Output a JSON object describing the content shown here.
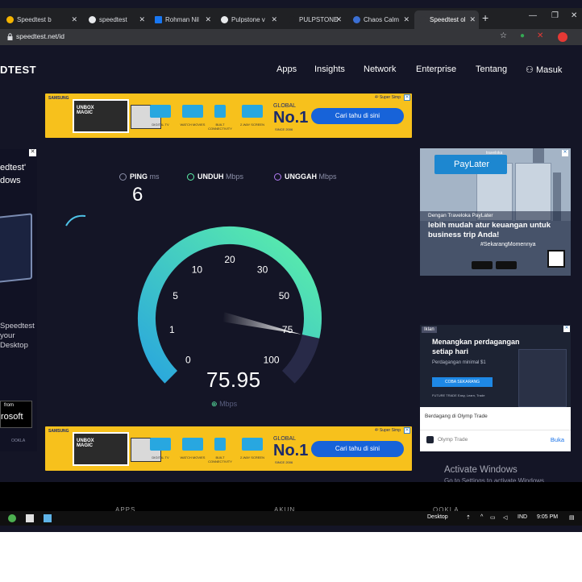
{
  "browser": {
    "tabs": [
      {
        "label": "Speedtest b"
      },
      {
        "label": "speedtest"
      },
      {
        "label": "Rohman Nil"
      },
      {
        "label": "Pulpstone v"
      },
      {
        "label": "PULPSTONE"
      },
      {
        "label": "Chaos Calm"
      },
      {
        "label": "Speedtest ol"
      }
    ],
    "url": "speedtest.net/id"
  },
  "site": {
    "logo": "DTEST",
    "nav": [
      "Apps",
      "Insights",
      "Network",
      "Enterprise",
      "Tentang"
    ],
    "login": "Masuk"
  },
  "banner_ad": {
    "brand": "SAMSUNG",
    "box_text": "UNBOX MAGIC",
    "features": [
      "DIGITAL TV",
      "WATCH MOVIES",
      "BUILT CONNECTIVITY",
      "2-WAY SCREEN"
    ],
    "global": "GLOBAL",
    "no1": "No.1",
    "since": "SINCE 2006",
    "super_simple": "4² Super Simp",
    "cta": "Cari tahu di sini"
  },
  "left_ad": {
    "line1": "edtest'",
    "line2": "dows",
    "line3": "Speedtest",
    "line4": "your",
    "line5": "Desktop",
    "ms_top": "from",
    "ms_bottom": "rosoft",
    "ookla": "OOKLA"
  },
  "metrics": {
    "ping_label": "PING",
    "ping_unit": "ms",
    "ping_value": "6",
    "download_label": "UNDUH",
    "download_unit": "Mbps",
    "upload_label": "UNGGAH",
    "upload_unit": "Mbps"
  },
  "gauge": {
    "ticks": [
      "0",
      "1",
      "5",
      "10",
      "20",
      "30",
      "50",
      "75",
      "100"
    ],
    "speed": "75.95",
    "unit": "Mbps",
    "needle_value": 75.95,
    "colors": {
      "low": "#2aa7dd",
      "high": "#5cf0a8",
      "track": "#282a48"
    }
  },
  "travel_ad": {
    "brand": "traveloka",
    "product": "PayLater",
    "line1": "Dengan Traveloka PayLater",
    "line2": "lebih mudah atur keuangan untuk business trip Anda!",
    "hashtag": "#SekarangMomennya"
  },
  "olymp_ad": {
    "iklan": "Iklan",
    "headline": "Menangkan perdagangan setiap hari",
    "sub": "Perdagangan minimal $1",
    "button": "COBA SEKARANG",
    "tiny": "FUTURE TRADE  Easy, Learn, Trade",
    "desc": "Berdagang di Olymp Trade",
    "source": "Olymp Trade",
    "open": "Buka"
  },
  "windows": {
    "activate_title": "Activate Windows",
    "activate_sub": "Go to Settings to activate Windows.",
    "footer_left": "APPS",
    "footer_right": "AKUN",
    "footer_logo": "OOKLA",
    "desktop": "Desktop",
    "lang": "IND",
    "time": "9:05 PM"
  }
}
